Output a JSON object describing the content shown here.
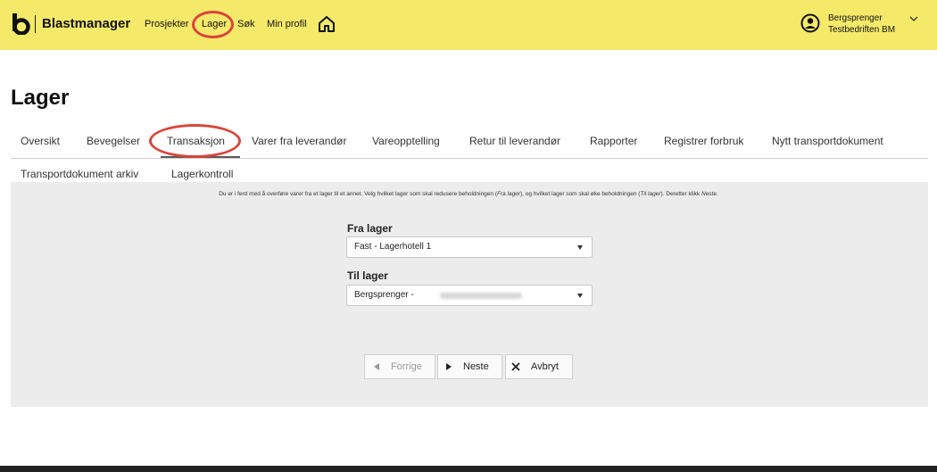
{
  "header": {
    "brand": "Blastmanager",
    "nav": [
      "Prosjekter",
      "Lager",
      "Søk",
      "Min profil"
    ],
    "user_line1": "Bergsprenger",
    "user_line2": "Testbedriften BM",
    "accent_color": "#f5e96a",
    "highlight_color": "#d9463b"
  },
  "page": {
    "title": "Lager"
  },
  "tabs_row1": [
    "Oversikt",
    "Bevegelser",
    "Transaksjon",
    "Varer fra leverandør",
    "Vareopptelling",
    "Retur til leverandør",
    "Rapporter",
    "Registrer forbruk",
    "Nytt transportdokument"
  ],
  "tabs_row2": [
    "Transportdokument arkiv",
    "Lagerkontroll"
  ],
  "active_tab": "Transaksjon",
  "form": {
    "info_part1": "Du er i ferd med å overføre varer fra et lager til et annet. Velg hvilket lager som skal redusere beholdningen (",
    "info_fra": "Fra lager",
    "info_part2": "), og hvilket lager som skal øke beholdningen (",
    "info_til": "Til lager",
    "info_part3": "). Deretter klikk ",
    "info_neste": "Neste",
    "info_part4": ".",
    "fra_label": "Fra lager",
    "fra_value": "Fast - Lagerhotell 1",
    "til_label": "Til lager",
    "til_value": "Bergsprenger -"
  },
  "buttons": {
    "prev": "Forrige",
    "next": "Neste",
    "cancel": "Avbryt"
  }
}
